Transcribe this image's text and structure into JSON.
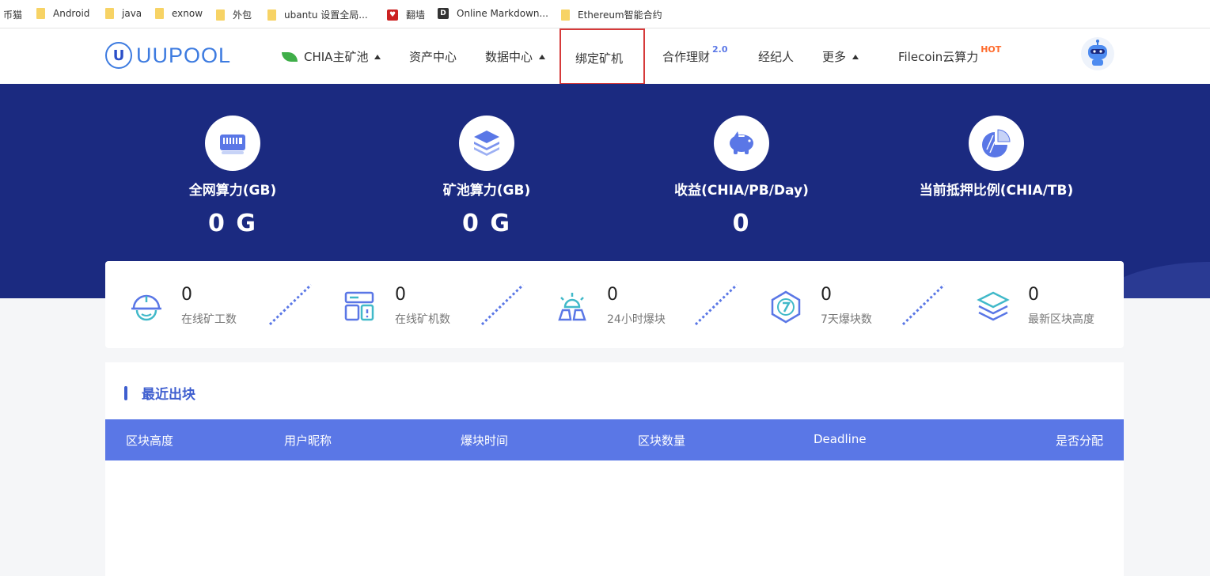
{
  "bookmarks": [
    {
      "label": "币猫",
      "type": "text"
    },
    {
      "label": "Android",
      "type": "folder"
    },
    {
      "label": "java",
      "type": "folder"
    },
    {
      "label": "exnow",
      "type": "folder"
    },
    {
      "label": "外包",
      "type": "folder"
    },
    {
      "label": "ubantu 设置全局...",
      "type": "folder"
    },
    {
      "label": "翻墙",
      "type": "favicon-red"
    },
    {
      "label": "Online Markdown...",
      "type": "favicon-d"
    },
    {
      "label": "Ethereum智能合约",
      "type": "folder"
    }
  ],
  "logo": {
    "mark": "U",
    "text": "UUPOOL"
  },
  "nav": {
    "chia": "CHIA主矿池",
    "assets": "资产中心",
    "data": "数据中心",
    "bind": "绑定矿机",
    "finance": "合作理财",
    "finance_badge": "2.0",
    "broker": "经纪人",
    "more": "更多",
    "filecoin": "Filecoin云算力",
    "filecoin_badge": "HOT"
  },
  "stats": [
    {
      "label": "全网算力(GB)",
      "value": "0 G",
      "icon": "hard-drive-icon"
    },
    {
      "label": "矿池算力(GB)",
      "value": "0 G",
      "icon": "layers-icon"
    },
    {
      "label": "收益(CHIA/PB/Day)",
      "value": "0",
      "icon": "piggy-bank-icon"
    },
    {
      "label": "当前抵押比例(CHIA/TB)",
      "value": "",
      "icon": "pie-chart-icon"
    }
  ],
  "counters": [
    {
      "value": "0",
      "label": "在线矿工数",
      "icon": "helmet-icon"
    },
    {
      "value": "0",
      "label": "在线矿机数",
      "icon": "server-icon"
    },
    {
      "value": "0",
      "label": "24小时爆块",
      "icon": "alarm-icon"
    },
    {
      "value": "0",
      "label": "7天爆块数",
      "icon": "seven-day-icon"
    },
    {
      "value": "0",
      "label": "最新区块高度",
      "icon": "stack-icon"
    }
  ],
  "recent": {
    "title": "最近出块",
    "columns": [
      "区块高度",
      "用户昵称",
      "爆块时间",
      "区块数量",
      "Deadline",
      "是否分配"
    ]
  },
  "colors": {
    "hero": "#1b2a80",
    "accent": "#3e5ecf",
    "table_head": "#5a77e6",
    "highlight": "#d63a3a"
  }
}
